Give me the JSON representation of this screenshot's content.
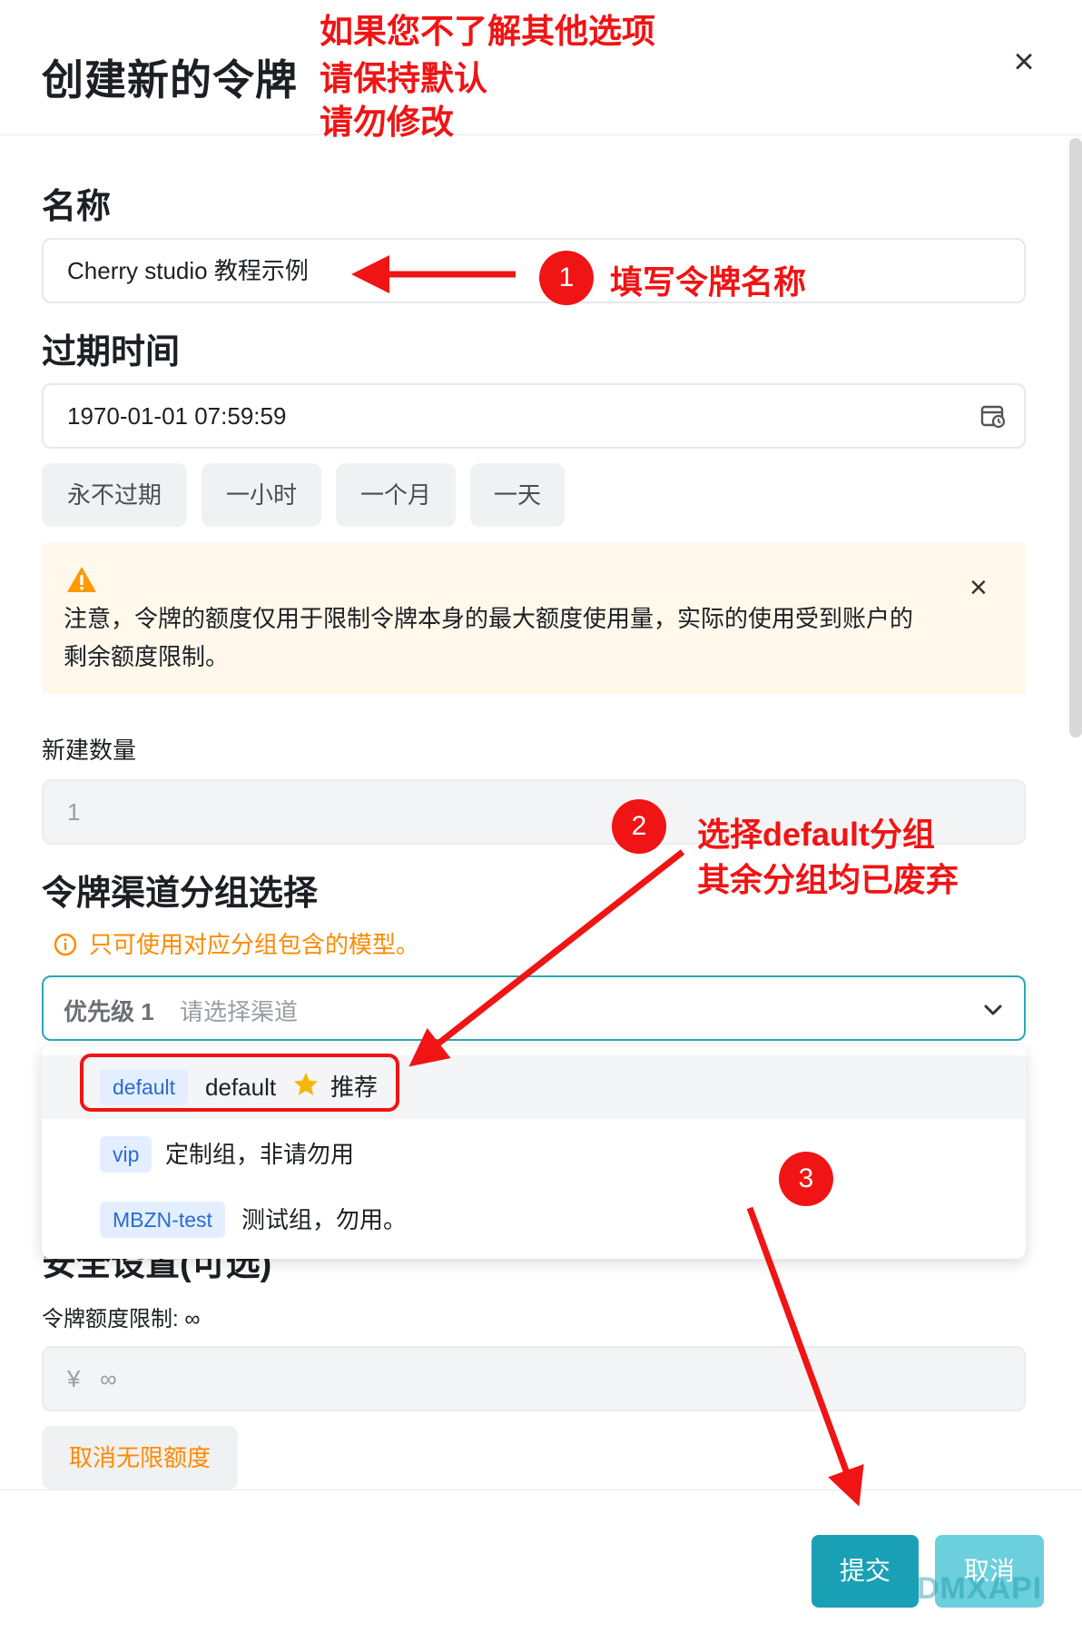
{
  "modal": {
    "title": "创建新的令牌"
  },
  "annotations": {
    "top_lines": [
      "如果您不了解其他选项",
      "请保持默认",
      "请勿修改"
    ],
    "badge_1": "1",
    "note_1": "填写令牌名称",
    "badge_2": "2",
    "note_2_line1": "选择default分组",
    "note_2_line2": "其余分组均已废弃",
    "badge_3": "3"
  },
  "name_section": {
    "title": "名称",
    "value": "Cherry studio 教程示例"
  },
  "expire_section": {
    "title": "过期时间",
    "value": "1970-01-01 07:59:59",
    "quick_buttons": [
      "永不过期",
      "一小时",
      "一个月",
      "一天"
    ]
  },
  "warning": {
    "icon": "warning-triangle-icon",
    "text": "注意，令牌的额度仅用于限制令牌本身的最大额度使用量，实际的使用受到账户的剩余额度限制。"
  },
  "count_section": {
    "label": "新建数量",
    "value": "1"
  },
  "group_section": {
    "title": "令牌渠道分组选择",
    "hint": "只可使用对应分组包含的模型。",
    "priority_label": "优先级 1",
    "placeholder": "请选择渠道",
    "options": [
      {
        "tag": "default",
        "text": "default",
        "badge_icon": "star-icon",
        "suffix": "推荐"
      },
      {
        "tag": "vip",
        "text": "定制组，非请勿用"
      },
      {
        "tag": "MBZN-test",
        "text": "测试组，勿用。"
      }
    ]
  },
  "security_section": {
    "title": "安全设置(可选)",
    "quota_label": "令牌额度限制: ∞",
    "quota_prefix": "¥",
    "quota_value": "∞",
    "cancel_unlimited": "取消无限额度"
  },
  "footer": {
    "submit": "提交",
    "cancel": "取消",
    "watermark": "DMXAPI"
  },
  "colors": {
    "accent": "#1aa0b4",
    "annotation_red": "#f01414",
    "hint_orange": "#ff8a00",
    "warning_bg": "#fff8eb"
  }
}
